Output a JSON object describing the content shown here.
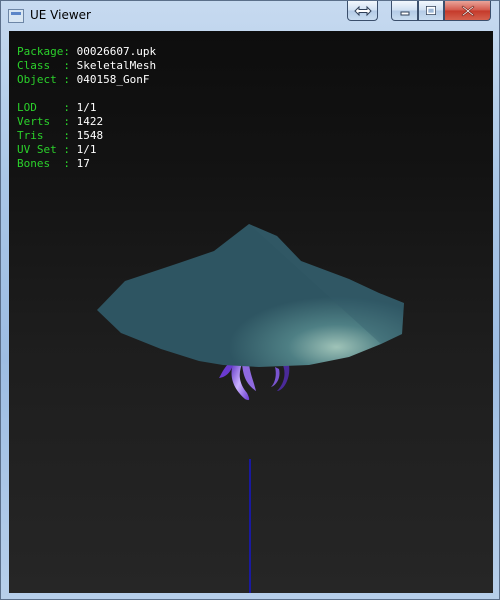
{
  "window": {
    "title": "UE Viewer",
    "icon": "app-icon",
    "controls": [
      "restore-icon",
      "minimize-icon",
      "maximize-icon",
      "close-icon"
    ],
    "close_color": "#c7402f"
  },
  "info": {
    "package_label": "Package: ",
    "package_value": "00026607.upk",
    "class_label": "Class  : ",
    "class_value": "SkeletalMesh",
    "object_label": "Object : ",
    "object_value": "040158_GonF",
    "lod_label": "LOD    : ",
    "lod_value": "1/1",
    "verts_label": "Verts  : ",
    "verts_value": "1422",
    "tris_label": "Tris   : ",
    "tris_value": "1548",
    "uvset_label": "UV Set : ",
    "uvset_value": "1/1",
    "bones_label": "Bones  : ",
    "bones_value": "17"
  },
  "colors": {
    "label": "#2bd12b",
    "value": "#ffffff",
    "mesh": "#2e5562",
    "tentacles": "#7a45d8",
    "axis": "#1616c8"
  }
}
